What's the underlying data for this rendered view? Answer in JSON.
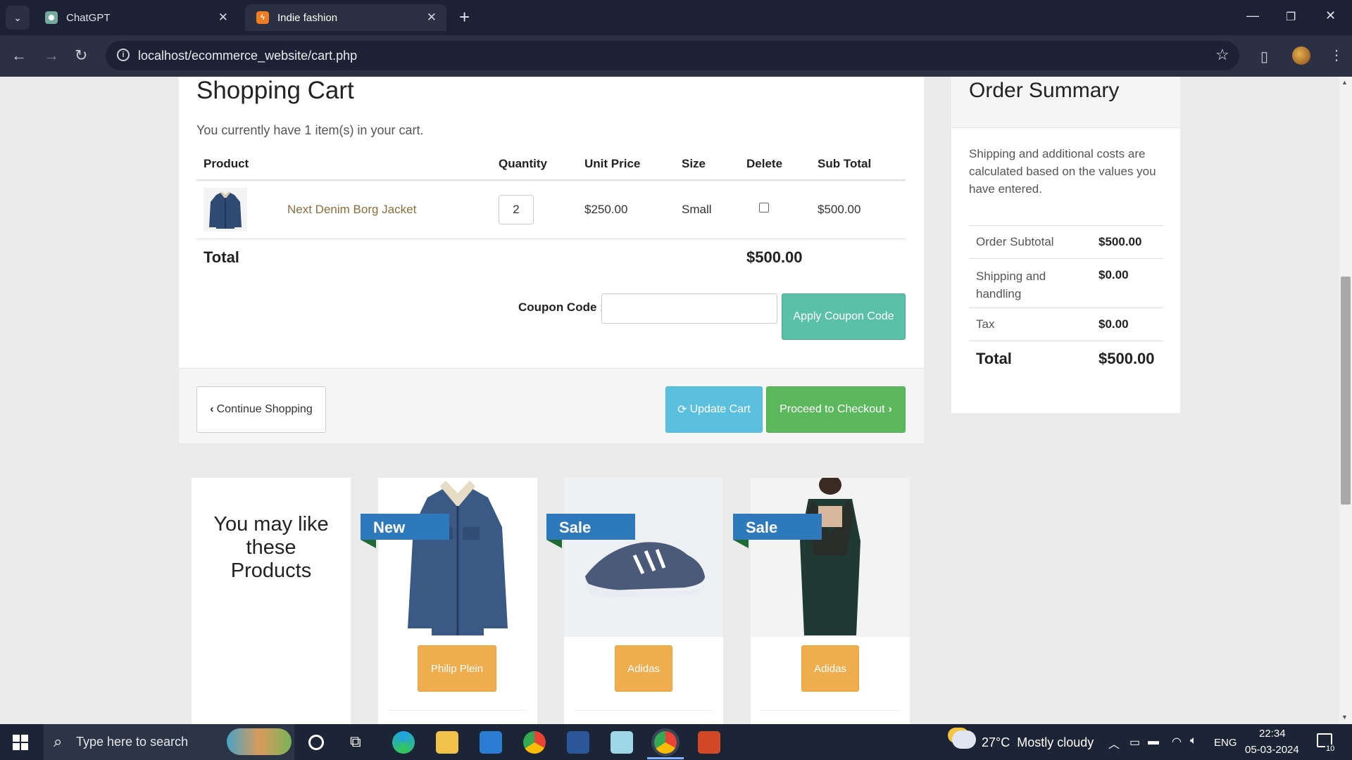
{
  "browser": {
    "tabs": [
      {
        "title": "ChatGPT",
        "active": false
      },
      {
        "title": "Indie fashion",
        "active": true
      }
    ],
    "url": "localhost/ecommerce_website/cart.php"
  },
  "cart": {
    "title": "Shopping Cart",
    "count_text": "You currently have 1 item(s) in your cart.",
    "headers": [
      "Product",
      "Quantity",
      "Unit Price",
      "Size",
      "Delete",
      "Sub Total"
    ],
    "items": [
      {
        "name": "Next Denim Borg Jacket",
        "quantity": "2",
        "unit_price": "$250.00",
        "size": "Small",
        "subtotal": "$500.00"
      }
    ],
    "total_label": "Total",
    "total_value": "$500.00",
    "coupon_label": "Coupon Code :",
    "coupon_value": "",
    "apply_label": "Apply Coupon Code",
    "continue_label": "Continue Shopping",
    "update_label": "Update Cart",
    "checkout_label": "Proceed to Checkout"
  },
  "summary": {
    "title": "Order Summary",
    "note": "Shipping and additional costs are calculated based on the values you have entered.",
    "rows": [
      {
        "label": "Order Subtotal",
        "value": "$500.00"
      },
      {
        "label": "Shipping and handling",
        "value": "$0.00"
      },
      {
        "label": "Tax",
        "value": "$0.00"
      }
    ],
    "total_label": "Total",
    "total_value": "$500.00"
  },
  "recommend": {
    "title": "You may like these Products",
    "products": [
      {
        "badge": "New",
        "brand": "Philip Plein"
      },
      {
        "badge": "Sale",
        "brand": "Adidas"
      },
      {
        "badge": "Sale",
        "brand": "Adidas"
      }
    ]
  },
  "taskbar": {
    "search_placeholder": "Type here to search",
    "weather": "27°C  Mostly cloudy",
    "lang": "ENG",
    "time": "22:34",
    "date": "05-03-2024",
    "notif_count": "10"
  },
  "colors": {
    "accent_teal": "#5bc0a8",
    "info": "#5bc0de",
    "success": "#5cb85c",
    "warning": "#f0ad4e",
    "badge_blue": "#2e78bc",
    "link_brown": "#8a6d3b"
  }
}
